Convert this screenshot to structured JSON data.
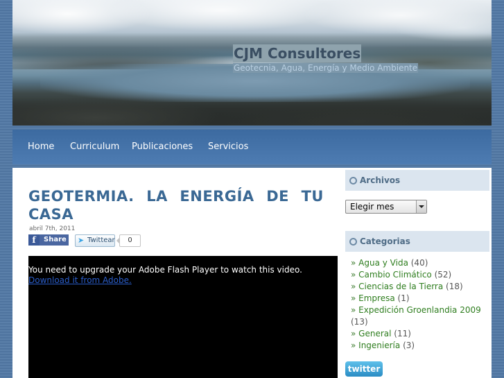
{
  "site": {
    "title": "CJM Consultores",
    "description": "Geotecnia, Agua, Energía y Medio Ambiente"
  },
  "nav": {
    "items": [
      "Home",
      "Curriculum",
      "Publicaciones",
      "Servicios"
    ]
  },
  "post": {
    "title_line1": "GEOTERMIA. LA ENERGÍA DE TU",
    "title_line2": "CASA",
    "date": "abril 7th, 2011",
    "share_label": "Share",
    "twitter_label": "Twittear",
    "twitter_count": "0",
    "video_message": "You need to upgrade your Adobe Flash Player to watch this video.",
    "video_link": "Download it from Adobe."
  },
  "sidebar": {
    "archives_title": "Archivos",
    "archives_select": "Elegir mes",
    "categories_title": "Categorias",
    "categories": [
      {
        "name": "Agua y Vida",
        "count": "(40)"
      },
      {
        "name": "Cambio Climático",
        "count": "(52)"
      },
      {
        "name": "Ciencias de la Tierra",
        "count": "(18)"
      },
      {
        "name": "Empresa",
        "count": "(1)"
      },
      {
        "name": "Expedición Groenlandia 2009",
        "count": "(13)"
      },
      {
        "name": "General",
        "count": "(11)"
      },
      {
        "name": "Ingeniería",
        "count": "(3)"
      }
    ],
    "twitter_badge": "twitter"
  },
  "colors": {
    "accent": "#3a6894",
    "nav_bg": "#4a78ae",
    "link_green": "#2e7d1e"
  }
}
